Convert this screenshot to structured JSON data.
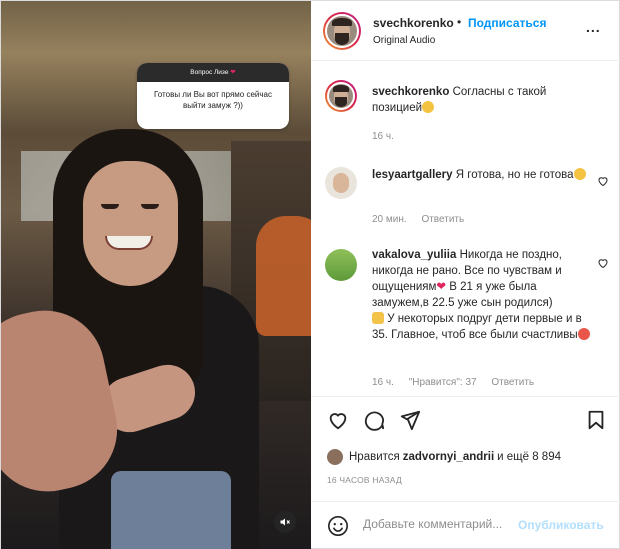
{
  "media": {
    "question_title": "Вопрос Лизе",
    "question_text": "Готовы ли Вы вот прямо сейчас выйти замуж ?))",
    "sound_icon": "sound-off-icon"
  },
  "header": {
    "username": "svechkorenko",
    "dot": "•",
    "follow_label": "Подписаться",
    "audio": "Original Audio",
    "more": "..."
  },
  "caption": {
    "username": "svechkorenko",
    "text": "Согласны с такой позицией",
    "time": "16 ч."
  },
  "comments": [
    {
      "username": "lesyaartgallery",
      "text": "Я готова, но не готова",
      "time": "20 мин.",
      "reply": "Ответить"
    },
    {
      "username": "vakalova_yuliia",
      "text": "Никогда не поздно, никогда не рано. Все по чувствам и ощущениям",
      "text2": " В 21 я уже была замужем,в 22.5 уже сын родился)",
      "text3": " У некоторых подруг дети первые и в 35. Главное, чтоб все были счастливы",
      "time": "16 ч.",
      "likes": "\"Нравится\": 37",
      "reply": "Ответить"
    }
  ],
  "actions": [
    "heart-icon",
    "comment-icon",
    "share-icon",
    "bookmark-icon"
  ],
  "likes": {
    "prefix": "Нравится",
    "user": "zadvornyi_andrii",
    "suffix": "и ещё 8 894"
  },
  "timeago": "16 ЧАСОВ НАЗАД",
  "add_comment": {
    "placeholder": "Добавьте комментарий...",
    "publish_label": "Опубликовать"
  },
  "colors": {
    "accent": "#0095f6",
    "publish_disabled": "#b2dffc",
    "secondary_text": "#8e8e8e",
    "heart_red": "#ed4956"
  }
}
